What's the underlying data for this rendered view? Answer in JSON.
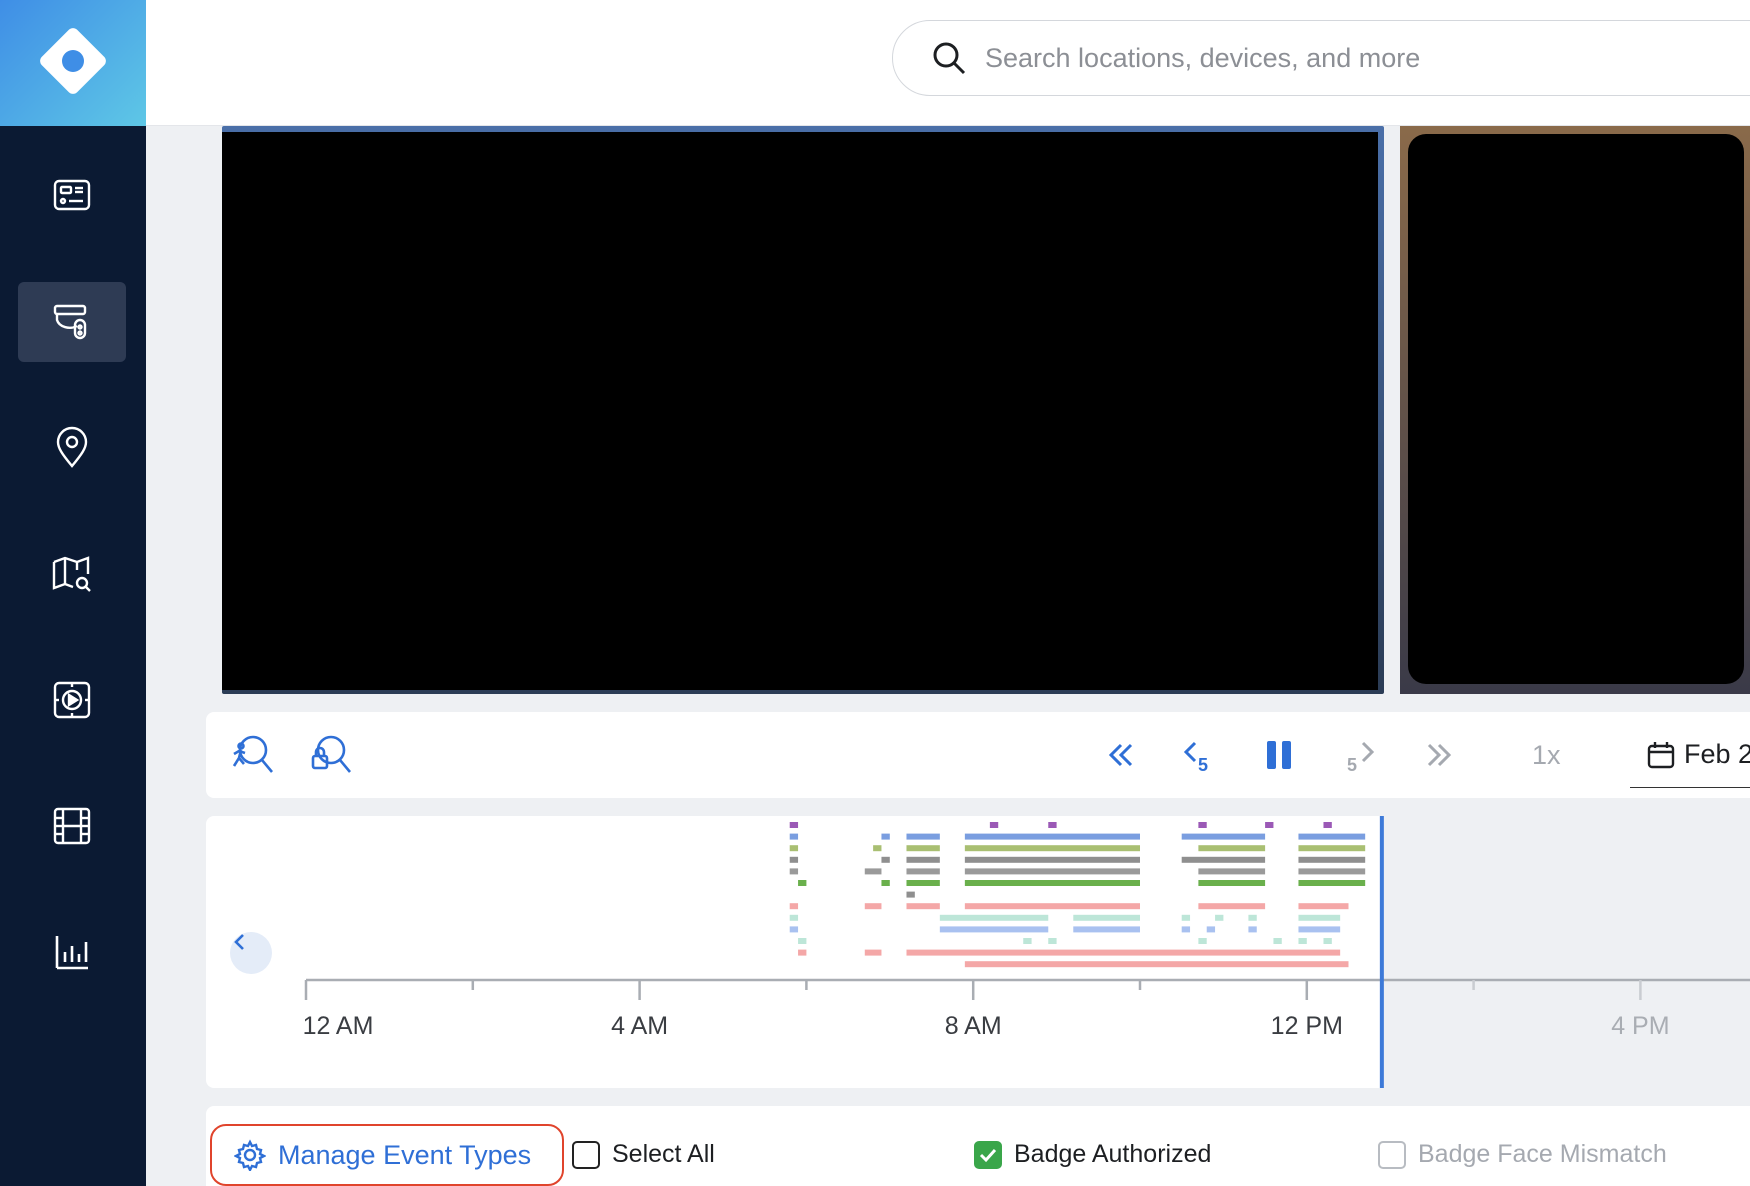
{
  "sidebar": {
    "logo_icon": "diamond-logo-icon",
    "items": [
      {
        "name": "dashboard",
        "icon": "dashboard-icon",
        "active": false
      },
      {
        "name": "devices",
        "icon": "camera-devices-icon",
        "active": true
      },
      {
        "name": "locations",
        "icon": "location-pin-icon",
        "active": false
      },
      {
        "name": "maps",
        "icon": "map-search-icon",
        "active": false
      },
      {
        "name": "video-wall",
        "icon": "video-wall-icon",
        "active": false
      },
      {
        "name": "clips",
        "icon": "film-icon",
        "active": false
      },
      {
        "name": "reports",
        "icon": "bar-chart-icon",
        "active": false
      }
    ]
  },
  "search": {
    "placeholder": "Search locations, devices, and more",
    "value": ""
  },
  "controls": {
    "speed": "1x",
    "date": "Feb 2",
    "buttons": [
      "person-search-icon",
      "lock-search-icon",
      "skip-back-double-icon",
      "back-5-icon",
      "pause-icon",
      "forward-5-icon",
      "skip-forward-double-icon"
    ]
  },
  "timeline": {
    "tick_labels": [
      {
        "label": "12 AM",
        "hour": 0
      },
      {
        "label": "4 AM",
        "hour": 4
      },
      {
        "label": "8 AM",
        "hour": 8
      },
      {
        "label": "12 PM",
        "hour": 12
      },
      {
        "label": "4 PM",
        "hour": 16
      }
    ],
    "current_hour": 12.9,
    "rows": [
      {
        "color": "#9b59b6",
        "segments": [
          [
            5.8,
            5.9
          ],
          [
            8.2,
            8.3
          ],
          [
            8.9,
            9.0
          ],
          [
            10.7,
            10.8
          ],
          [
            11.5,
            11.6
          ],
          [
            12.2,
            12.3
          ]
        ]
      },
      {
        "color": "#7a9ee0",
        "segments": [
          [
            5.8,
            5.9
          ],
          [
            6.9,
            7.0
          ],
          [
            7.2,
            7.6
          ],
          [
            7.9,
            10.0
          ],
          [
            10.5,
            11.5
          ],
          [
            11.9,
            12.7
          ]
        ]
      },
      {
        "color": "#a9bf72",
        "segments": [
          [
            5.8,
            5.9
          ],
          [
            6.8,
            6.9
          ],
          [
            7.2,
            7.6
          ],
          [
            7.9,
            10.0
          ],
          [
            10.7,
            11.5
          ],
          [
            11.9,
            12.7
          ]
        ]
      },
      {
        "color": "#8f8f8f",
        "segments": [
          [
            5.8,
            5.9
          ],
          [
            6.9,
            7.0
          ],
          [
            7.2,
            7.6
          ],
          [
            7.9,
            10.0
          ],
          [
            10.5,
            11.5
          ],
          [
            11.9,
            12.7
          ]
        ]
      },
      {
        "color": "#9a9a9a",
        "segments": [
          [
            5.8,
            5.9
          ],
          [
            6.7,
            6.9
          ],
          [
            7.2,
            7.6
          ],
          [
            7.9,
            10.0
          ],
          [
            10.7,
            11.5
          ],
          [
            11.9,
            12.7
          ]
        ]
      },
      {
        "color": "#6ab04c",
        "segments": [
          [
            5.9,
            6.0
          ],
          [
            6.9,
            7.0
          ],
          [
            7.2,
            7.6
          ],
          [
            7.9,
            10.0
          ],
          [
            10.7,
            11.5
          ],
          [
            11.9,
            12.7
          ]
        ]
      },
      {
        "color": "#8f8f8f",
        "segments": [
          [
            7.2,
            7.3
          ]
        ]
      },
      {
        "color": "#f4a7a7",
        "segments": [
          [
            5.8,
            5.9
          ],
          [
            6.7,
            6.9
          ],
          [
            7.2,
            7.6
          ],
          [
            7.9,
            10.0
          ],
          [
            10.7,
            11.5
          ],
          [
            11.9,
            12.5
          ]
        ]
      },
      {
        "color": "#bde6d8",
        "segments": [
          [
            5.8,
            5.9
          ],
          [
            7.6,
            8.9
          ],
          [
            9.2,
            10.0
          ],
          [
            10.5,
            10.6
          ],
          [
            10.9,
            11.0
          ],
          [
            11.3,
            11.4
          ],
          [
            11.9,
            12.4
          ]
        ]
      },
      {
        "color": "#a9c1f0",
        "segments": [
          [
            5.8,
            5.9
          ],
          [
            7.6,
            8.9
          ],
          [
            9.2,
            10.0
          ],
          [
            10.5,
            10.6
          ],
          [
            10.8,
            10.9
          ],
          [
            11.3,
            11.4
          ],
          [
            11.9,
            12.4
          ]
        ]
      },
      {
        "color": "#bde6d8",
        "segments": [
          [
            5.9,
            6.0
          ],
          [
            8.6,
            8.7
          ],
          [
            8.9,
            9.0
          ],
          [
            10.7,
            10.8
          ],
          [
            11.6,
            11.7
          ],
          [
            11.9,
            12.0
          ],
          [
            12.2,
            12.3
          ]
        ]
      },
      {
        "color": "#f4a7a7",
        "segments": [
          [
            5.9,
            6.0
          ],
          [
            6.7,
            6.9
          ],
          [
            7.2,
            12.4
          ]
        ]
      },
      {
        "color": "#f4a7a7",
        "segments": [
          [
            7.9,
            12.5
          ]
        ]
      }
    ]
  },
  "events": {
    "manage_label": "Manage Event Types",
    "types": [
      {
        "label": "Select All",
        "checked": false,
        "disabled": false
      },
      {
        "label": "Badge Authorized",
        "checked": true,
        "disabled": false
      },
      {
        "label": "Badge Face Mismatch",
        "checked": false,
        "disabled": true
      }
    ]
  }
}
